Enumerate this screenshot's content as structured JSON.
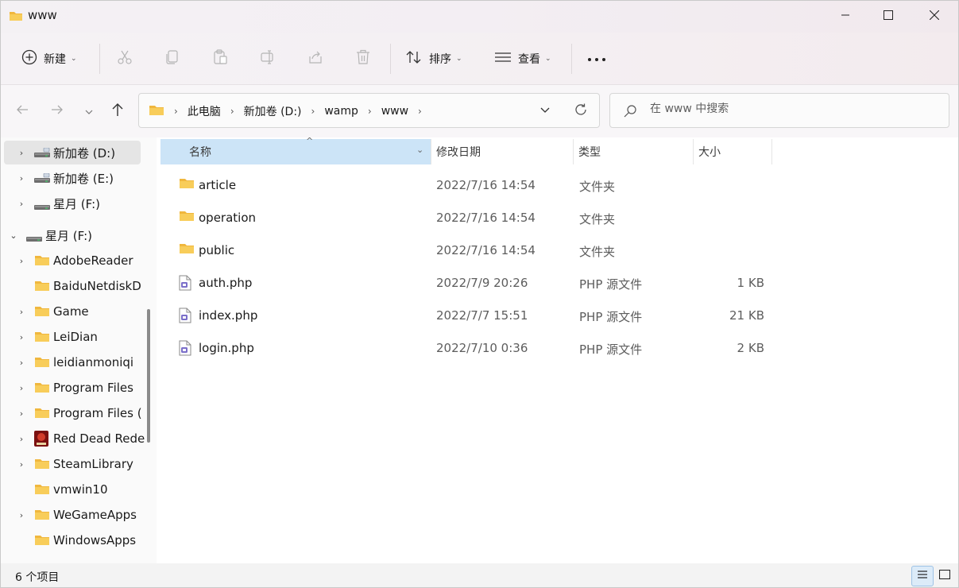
{
  "window": {
    "title": "www",
    "icons": {
      "folder": "folder-icon",
      "minimize": "minimize-icon",
      "maximize": "maximize-icon",
      "close": "close-icon"
    }
  },
  "toolbar": {
    "new_label": "新建",
    "sort_label": "排序",
    "view_label": "查看",
    "icons": [
      "new-icon",
      "cut-icon",
      "copy-icon",
      "paste-icon",
      "rename-icon",
      "share-icon",
      "delete-icon",
      "sort-icon",
      "view-icon",
      "more-icon"
    ]
  },
  "address": {
    "breadcrumbs": [
      "此电脑",
      "新加卷 (D:)",
      "wamp",
      "www"
    ],
    "search_placeholder": "在 www 中搜索"
  },
  "sidebar": {
    "items": [
      {
        "label": "新加卷 (D:)",
        "icon": "drive-icon",
        "expandable": true,
        "selected": true,
        "level": 1
      },
      {
        "label": "新加卷 (E:)",
        "icon": "drive-icon",
        "expandable": true,
        "selected": false,
        "level": 1
      },
      {
        "label": "星月 (F:)",
        "icon": "drive-icon",
        "expandable": true,
        "selected": false,
        "level": 1
      },
      {
        "label": "星月 (F:)",
        "icon": "drive-icon",
        "expandable": true,
        "expanded": true,
        "selected": false,
        "level": 0
      },
      {
        "label": "AdobeReader",
        "icon": "folder-icon",
        "expandable": true,
        "level": 1
      },
      {
        "label": "BaiduNetdiskD",
        "icon": "folder-icon",
        "expandable": false,
        "level": 1
      },
      {
        "label": "Game",
        "icon": "folder-icon",
        "expandable": true,
        "level": 1
      },
      {
        "label": "LeiDian",
        "icon": "folder-icon",
        "expandable": true,
        "level": 1
      },
      {
        "label": "leidianmoniqi",
        "icon": "folder-icon",
        "expandable": true,
        "level": 1
      },
      {
        "label": "Program Files",
        "icon": "folder-icon",
        "expandable": true,
        "level": 1
      },
      {
        "label": "Program Files (",
        "icon": "folder-icon",
        "expandable": true,
        "level": 1
      },
      {
        "label": "Red Dead Rede",
        "icon": "game-icon",
        "expandable": true,
        "level": 1
      },
      {
        "label": "SteamLibrary",
        "icon": "folder-icon",
        "expandable": true,
        "level": 1
      },
      {
        "label": "vmwin10",
        "icon": "folder-icon",
        "expandable": false,
        "level": 1
      },
      {
        "label": "WeGameApps",
        "icon": "folder-icon",
        "expandable": true,
        "level": 1
      },
      {
        "label": "WindowsApps",
        "icon": "folder-icon",
        "expandable": false,
        "level": 1
      }
    ]
  },
  "list": {
    "columns": [
      "名称",
      "修改日期",
      "类型",
      "大小"
    ],
    "rows": [
      {
        "name": "article",
        "date": "2022/7/16 14:54",
        "type": "文件夹",
        "size": "",
        "icon": "folder-icon"
      },
      {
        "name": "operation",
        "date": "2022/7/16 14:54",
        "type": "文件夹",
        "size": "",
        "icon": "folder-icon"
      },
      {
        "name": "public",
        "date": "2022/7/16 14:54",
        "type": "文件夹",
        "size": "",
        "icon": "folder-icon"
      },
      {
        "name": "auth.php",
        "date": "2022/7/9 20:26",
        "type": "PHP 源文件",
        "size": "1 KB",
        "icon": "php-file-icon"
      },
      {
        "name": "index.php",
        "date": "2022/7/7 15:51",
        "type": "PHP 源文件",
        "size": "21 KB",
        "icon": "php-file-icon"
      },
      {
        "name": "login.php",
        "date": "2022/7/10 0:36",
        "type": "PHP 源文件",
        "size": "2 KB",
        "icon": "php-file-icon"
      }
    ]
  },
  "status": {
    "item_count": "6 个项目"
  },
  "colors": {
    "accent": "#0067c0",
    "folder": "#f4c24b",
    "selected_header": "#cce4f7",
    "php": "#7b6fc9"
  }
}
